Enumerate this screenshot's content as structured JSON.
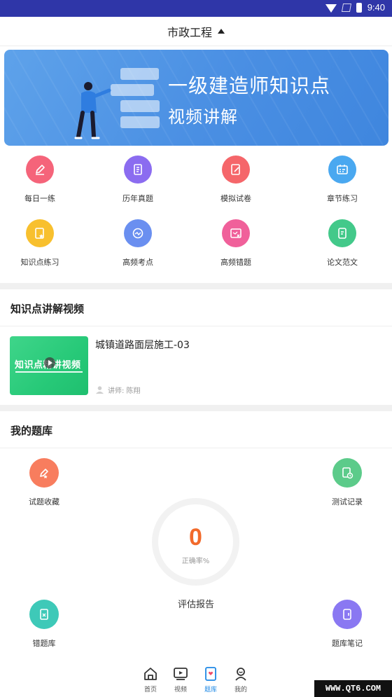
{
  "status_bar": {
    "time": "9:40"
  },
  "header": {
    "title": "市政工程"
  },
  "banner": {
    "line1": "一级建造师知识点",
    "line2": "视频讲解"
  },
  "menu": [
    {
      "label": "每日一练",
      "icon": "pencil-icon",
      "color": "#f5647a"
    },
    {
      "label": "历年真题",
      "icon": "document-icon",
      "color": "#8b6cf0"
    },
    {
      "label": "模拟试卷",
      "icon": "edit-paper-icon",
      "color": "#f5666a"
    },
    {
      "label": "章节练习",
      "icon": "calendar-icon",
      "color": "#4aa8f0"
    },
    {
      "label": "知识点练习",
      "icon": "star-paper-icon",
      "color": "#f8c02e"
    },
    {
      "label": "高频考点",
      "icon": "gauge-icon",
      "color": "#6a8ff0"
    },
    {
      "label": "高频错题",
      "icon": "error-paper-icon",
      "color": "#f0609a"
    },
    {
      "label": "论文范文",
      "icon": "essay-icon",
      "color": "#43c98a"
    }
  ],
  "video_section": {
    "title": "知识点讲解视频",
    "thumb_text": "知识点精讲视频",
    "video_title": "城镇道路面层施工-03",
    "lecturer": "讲师: 陈翔"
  },
  "bank_section": {
    "title": "我的题库",
    "items": [
      {
        "label": "试题收藏",
        "icon": "favorite-icon",
        "color": "#f87d5e"
      },
      {
        "label": "测试记录",
        "icon": "record-icon",
        "color": "#5ccb8a"
      },
      {
        "label": "错题库",
        "icon": "wrong-bank-icon",
        "color": "#3ec9b8"
      },
      {
        "label": "题库笔记",
        "icon": "notes-icon",
        "color": "#8a78f2"
      }
    ],
    "score": "0",
    "rate_label": "正确率%",
    "report_label": "评估报告"
  },
  "bottom_nav": [
    {
      "label": "首页",
      "icon": "home-icon"
    },
    {
      "label": "视频",
      "icon": "video-icon"
    },
    {
      "label": "题库",
      "icon": "question-bank-icon",
      "active": true
    },
    {
      "label": "我的",
      "icon": "profile-icon"
    }
  ],
  "watermark": "WWW.QT6.COM",
  "colors": {
    "status_bar": "#2f36a8",
    "accent": "#1e88e5",
    "score": "#f26a2b"
  }
}
